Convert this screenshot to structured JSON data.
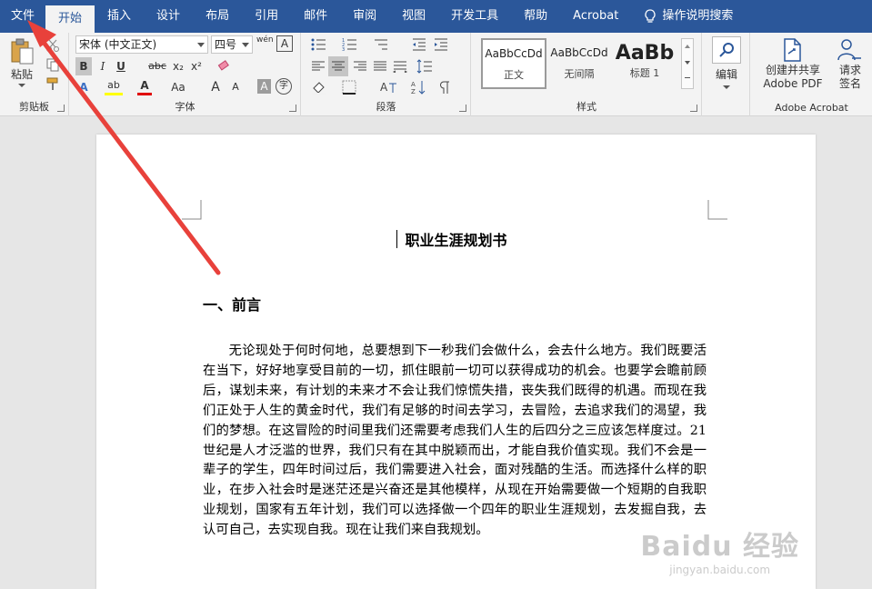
{
  "tabs": {
    "file": "文件",
    "home": "开始",
    "insert": "插入",
    "design": "设计",
    "layout": "布局",
    "references": "引用",
    "mailings": "邮件",
    "review": "审阅",
    "view": "视图",
    "developer": "开发工具",
    "help": "帮助",
    "acrobat": "Acrobat",
    "tell_me": "操作说明搜索"
  },
  "ribbon": {
    "clipboard": {
      "paste": "粘贴",
      "label": "剪贴板"
    },
    "font": {
      "family": "宋体 (中文正文)",
      "size": "四号",
      "label": "字体",
      "bold": "B",
      "italic": "I",
      "underline": "U",
      "strike": "abc",
      "subscript": "x₂",
      "superscript": "x²",
      "font_color": "A",
      "text_effects": "A",
      "change_case": "Aa",
      "grow": "A",
      "shrink": "A",
      "highlight": "ab",
      "char_shading": "A",
      "enclose": "字",
      "phonetic": "wén"
    },
    "paragraph": {
      "label": "段落"
    },
    "styles": {
      "label": "样式",
      "items": [
        {
          "sample": "AaBbCcDd",
          "name": "正文"
        },
        {
          "sample": "AaBbCcDd",
          "name": "无间隔"
        },
        {
          "sample": "AaBb",
          "name": "标题 1"
        }
      ]
    },
    "editing": {
      "label": "编辑"
    },
    "acrobat": {
      "create_share": "创建并共享",
      "create_share_line2": "Adobe PDF",
      "request_sign": "请求",
      "request_sign_line2": "签名",
      "label": "Adobe Acrobat"
    }
  },
  "document": {
    "title": "职业生涯规划书",
    "heading": "一、前言",
    "paragraph": "无论现处于何时何地，总要想到下一秒我们会做什么，会去什么地方。我们既要活在当下，好好地享受目前的一切，抓住眼前一切可以获得成功的机会。也要学会瞻前顾后，谋划未来，有计划的未来才不会让我们惊慌失措，丧失我们既得的机遇。而现在我们正处于人生的黄金时代，我们有足够的时间去学习，去冒险，去追求我们的渴望，我们的梦想。在这冒险的时间里我们还需要考虑我们人生的后四分之三应该怎样度过。21 世纪是人才泛滥的世界，我们只有在其中脱颖而出，才能自我价值实现。我们不会是一辈子的学生，四年时间过后，我们需要进入社会，面对残酷的生活。而选择什么样的职业，在步入社会时是迷茫还是兴奋还是其他模样，从现在开始需要做一个短期的自我职业规划，国家有五年计划，我们可以选择做一个四年的职业生涯规划，去发掘自我，去认可自己，去实现自我。现在让我们来自我规划。"
  },
  "watermark": {
    "top": "Baidu 经验",
    "bottom": "jingyan.baidu.com"
  },
  "colors": {
    "tab_bar": "#2b579a",
    "arrow": "#e8413b",
    "highlight": "#ffff00",
    "font_color_bar": "#e00000"
  },
  "icons": [
    "lightbulb-icon",
    "paste-icon",
    "cut-icon",
    "copy-icon",
    "format-painter-icon",
    "search-icon",
    "share-pdf-icon",
    "sign-icon"
  ]
}
